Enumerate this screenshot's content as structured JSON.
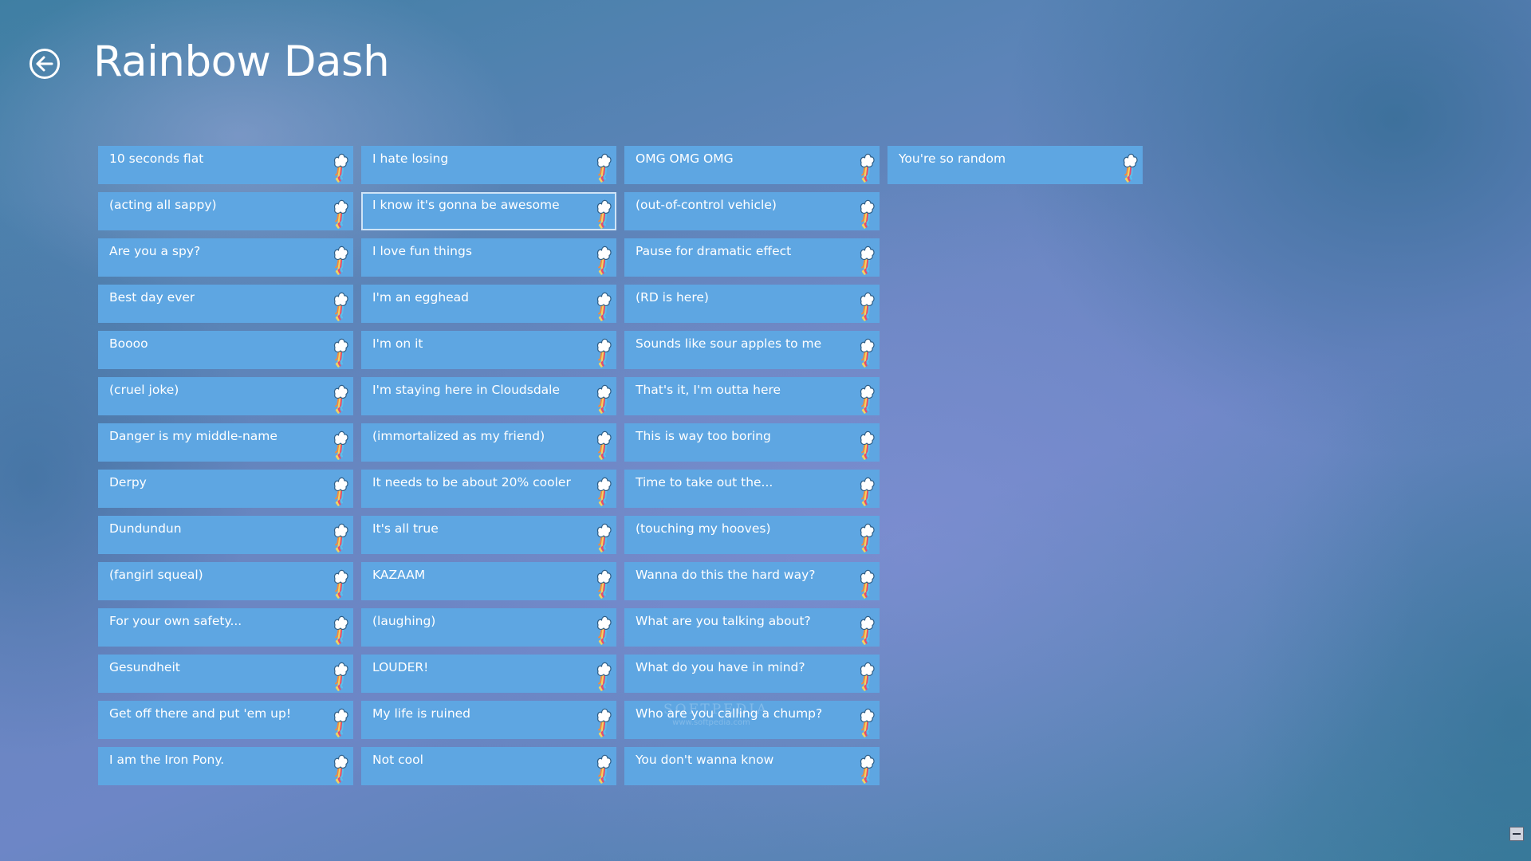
{
  "page": {
    "title": "Rainbow Dash"
  },
  "icons": {
    "back": "back-arrow-circle-icon",
    "tile": "cutie-mark-rainbow-bolt-icon",
    "zoom": "semantic-zoom-minus-icon"
  },
  "colors": {
    "tile_background": "#5ea6e2",
    "tile_text": "#ffffff",
    "selected_border": "#dcebfa"
  },
  "sounds": {
    "selected_label": "I know it's gonna be awesome",
    "columns": [
      [
        "10 seconds flat",
        "(acting all sappy)",
        "Are you a spy?",
        "Best day ever",
        "Boooo",
        "(cruel joke)",
        "Danger is my middle-name",
        "Derpy",
        "Dundundun",
        "(fangirl squeal)",
        "For your own safety...",
        "Gesundheit",
        "Get off there and put 'em up!",
        "I am the Iron Pony."
      ],
      [
        "I hate losing",
        "I know it's gonna be awesome",
        "I love fun things",
        "I'm an egghead",
        "I'm on it",
        "I'm staying here in Cloudsdale",
        "(immortalized as my friend)",
        "It needs to be about 20% cooler",
        "It's all true",
        "KAZAAM",
        "(laughing)",
        "LOUDER!",
        "My life is ruined",
        "Not cool"
      ],
      [
        "OMG OMG OMG",
        "(out-of-control vehicle)",
        "Pause for dramatic effect",
        "(RD is here)",
        "Sounds like sour apples to me",
        "That's it, I'm outta here",
        "This is way too boring",
        "Time to take out the...",
        "(touching my hooves)",
        "Wanna do this the hard way?",
        "What are you talking about?",
        "What do you have in mind?",
        "Who are you calling a chump?",
        "You don't wanna know"
      ],
      [
        "You're so random"
      ]
    ]
  },
  "watermark": {
    "brand": "SOFTPEDIA",
    "url": "www.softpedia.com"
  }
}
